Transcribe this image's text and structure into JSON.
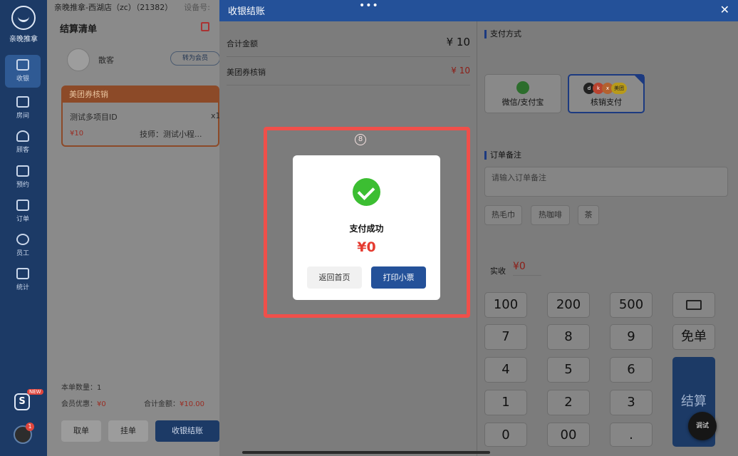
{
  "nav": {
    "logo_text": "亲晚推拿",
    "items": [
      {
        "label": "收银",
        "icon": "monitor-icon",
        "active": true
      },
      {
        "label": "房间",
        "icon": "house-icon"
      },
      {
        "label": "顾客",
        "icon": "person-icon"
      },
      {
        "label": "预约",
        "icon": "calendar-icon"
      },
      {
        "label": "订单",
        "icon": "clipboard-icon"
      },
      {
        "label": "员工",
        "icon": "people-icon"
      },
      {
        "label": "统计",
        "icon": "chart-icon"
      }
    ],
    "app_badge": "S",
    "new_tag": "NEW",
    "avatar_badge": "1"
  },
  "cart": {
    "store": "亲晚推拿-西湖店（zc）（21382）",
    "device": "设备号:",
    "title": "结算清单",
    "guest": "散客",
    "member_btn": "转为会员",
    "coupon_head": "美团券核销",
    "coupon_item": "测试多项目ID",
    "coupon_qty": "x1",
    "coupon_price": "¥10",
    "coupon_tech": "技师：测试小程...",
    "count_label": "本单数量：1",
    "member_disc_label": "会员优惠：",
    "member_disc_val": "¥0",
    "total_label": "合计金额：",
    "total_val": "¥10.00",
    "btn_take": "取单",
    "btn_hold": "挂单",
    "btn_checkout": "收银结账"
  },
  "modal": {
    "title": "收银结账",
    "dots": "•••",
    "close": "✕",
    "total_label": "合计金额",
    "total_value": "¥ 10",
    "coupon_label": "美团券核销",
    "coupon_value": "¥ 10",
    "pay_title": "支付方式",
    "pay_wechat": "微信/支付宝",
    "pay_verify": "核销支付",
    "pay_logos": [
      "d",
      "k",
      "x",
      "美团"
    ],
    "note_title": "订单备注",
    "note_placeholder": "请输入订单备注",
    "tags": [
      "热毛巾",
      "热咖啡",
      "茶"
    ],
    "paid_label": "实收",
    "paid_value": "¥0",
    "keys": [
      "100",
      "200",
      "500",
      "7",
      "8",
      "9",
      "4",
      "5",
      "6",
      "1",
      "2",
      "3",
      "0",
      "00",
      "."
    ],
    "key_free": "免单",
    "key_settle": "结算"
  },
  "dialog": {
    "step": "8",
    "status": "支付成功",
    "amount": "¥0",
    "btn_home": "返回首页",
    "btn_print": "打印小票"
  },
  "debug_btn": "调试",
  "colors": {
    "primary": "#245199",
    "success": "#3cbe32",
    "danger": "#e53b30",
    "highlight": "#f04f4a"
  }
}
